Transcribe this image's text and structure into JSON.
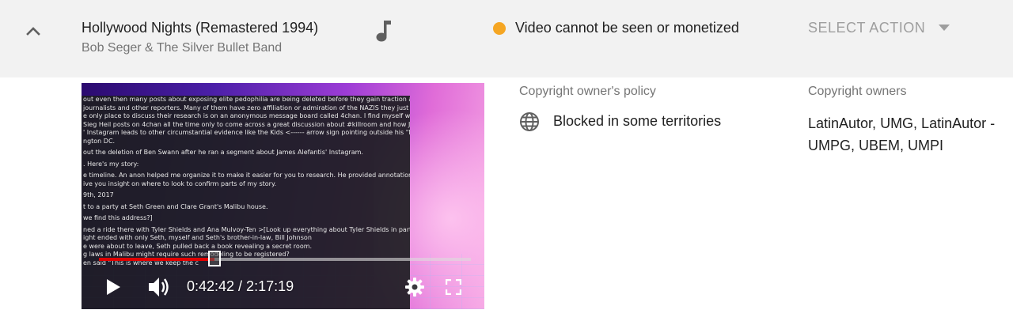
{
  "track": {
    "title": "Hollywood Nights (Remastered 1994)",
    "artist": "Bob Seger & The Silver Bullet Band",
    "type_icon": "music-note-icon"
  },
  "status": {
    "text": "Video cannot be seen or monetized",
    "color": "#f5a623"
  },
  "action": {
    "label": "SELECT ACTION"
  },
  "player": {
    "time_display": "0:42:42 / 2:17:19",
    "progress_fraction": 0.311,
    "progress_color": "#e00000",
    "document_lines": [
      "out even then many posts about exposing elite pedophilia are being deleted before they gain traction among",
      "journalists and other reporters. Many of them have zero affiliation or admiration of the NAZIS they just happen",
      "e only place to discuss their research is on an anonymous message board called 4chan. I find myself wading",
      "Sieg Heil posts on 4chan all the time only to come across a great discussion about #killroom and how James",
      "' Instagram leads to other circumstantial evidence like the Kids <------ arrow sign pointing outside his \"Museum\"",
      "ngton DC.",
      "out the deletion of Ben Swann after he ran a segment about James Alefantis' Instagram.",
      ". Here's my story:",
      "e timeline. An anon helped me organize it to make it easier for you to research. He provided annotations [like",
      "ive you insight on where to look to confirm parts of my story.",
      "9th, 2017",
      "t to a party at Seth Green and Clare Grant's Malibu house.",
      "we find this address?]",
      "ned a ride there with Tyler Shields and Ana Mulvoy-Ten >[Look up everything about Tyler Shields in particular]",
      "ight ended with only Seth, myself and Seth's brother-in-law, Bill Johnson",
      "e were about to leave, Seth pulled back a book revealing a secret room.",
      "g laws in Malibu might require such remodeling to be registered?",
      "en said \"This is where we keep the c"
    ]
  },
  "policy": {
    "label": "Copyright owner's policy",
    "value": "Blocked in some territories"
  },
  "owners": {
    "label": "Copyright owners",
    "value": "LatinAutor, UMG, LatinAutor - UMPG, UBEM, UMPI"
  }
}
